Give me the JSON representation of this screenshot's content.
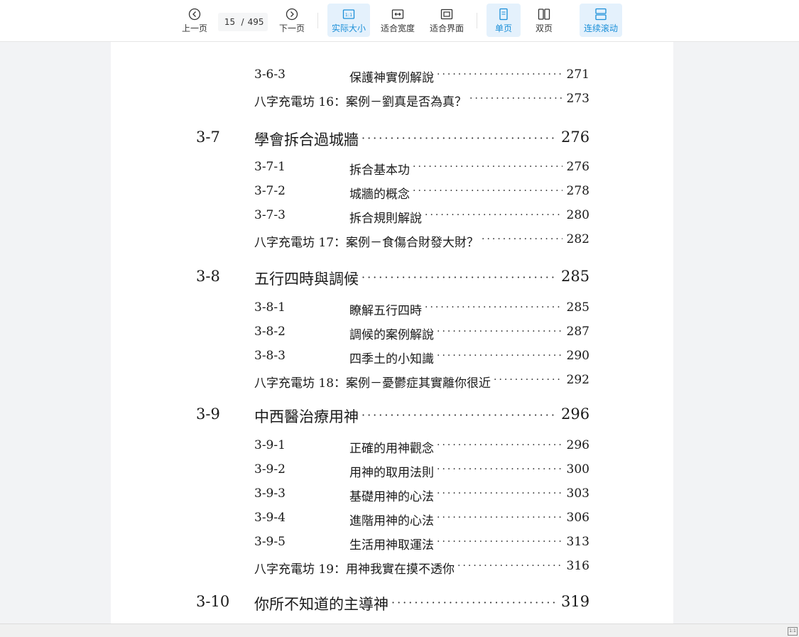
{
  "toolbar": {
    "prev": "上一页",
    "page_current": "15",
    "page_sep": "/",
    "page_total": "495",
    "next": "下一页",
    "actual_size": "实际大小",
    "actual_size_icon_text": "1:1",
    "fit_width": "适合宽度",
    "fit_page": "适合界面",
    "single_page": "单页",
    "double_page": "双页",
    "continuous_scroll": "连续滚动"
  },
  "toc": [
    {
      "level": "sub",
      "number": "3-6-3",
      "title": "保護神實例解說",
      "page": "271"
    },
    {
      "level": "extra",
      "number": "",
      "title": "八字充電坊 16：案例－劉真是否為真？",
      "page": "273"
    },
    {
      "level": "main",
      "number": "3-7",
      "title": "學會拆合過城牆",
      "page": "276"
    },
    {
      "level": "sub",
      "number": "3-7-1",
      "title": "拆合基本功",
      "page": "276"
    },
    {
      "level": "sub",
      "number": "3-7-2",
      "title": "城牆的概念",
      "page": "278"
    },
    {
      "level": "sub",
      "number": "3-7-3",
      "title": "拆合規則解說",
      "page": "280"
    },
    {
      "level": "extra",
      "number": "",
      "title": "八字充電坊 17：案例－食傷合財發大財？",
      "page": "282"
    },
    {
      "level": "main",
      "number": "3-8",
      "title": "五行四時與調候",
      "page": "285"
    },
    {
      "level": "sub",
      "number": "3-8-1",
      "title": "瞭解五行四時",
      "page": "285"
    },
    {
      "level": "sub",
      "number": "3-8-2",
      "title": "調候的案例解說",
      "page": "287"
    },
    {
      "level": "sub",
      "number": "3-8-3",
      "title": "四季土的小知識",
      "page": "290"
    },
    {
      "level": "extra",
      "number": "",
      "title": "八字充電坊 18：案例－憂鬱症其實離你很近",
      "page": "292"
    },
    {
      "level": "main",
      "number": "3-9",
      "title": "中西醫治療用神",
      "page": "296"
    },
    {
      "level": "sub",
      "number": "3-9-1",
      "title": "正確的用神觀念",
      "page": "296"
    },
    {
      "level": "sub",
      "number": "3-9-2",
      "title": "用神的取用法則",
      "page": "300"
    },
    {
      "level": "sub",
      "number": "3-9-3",
      "title": "基礎用神的心法",
      "page": "303"
    },
    {
      "level": "sub",
      "number": "3-9-4",
      "title": "進階用神的心法",
      "page": "306"
    },
    {
      "level": "sub",
      "number": "3-9-5",
      "title": "生活用神取運法",
      "page": "313"
    },
    {
      "level": "extra",
      "number": "",
      "title": "八字充電坊 19：用神我實在摸不透你",
      "page": "316"
    },
    {
      "level": "main",
      "number": "3-10",
      "title": "你所不知道的主導神",
      "page": "319"
    }
  ],
  "statusbar": {
    "zoom_indicator": "1:1"
  }
}
